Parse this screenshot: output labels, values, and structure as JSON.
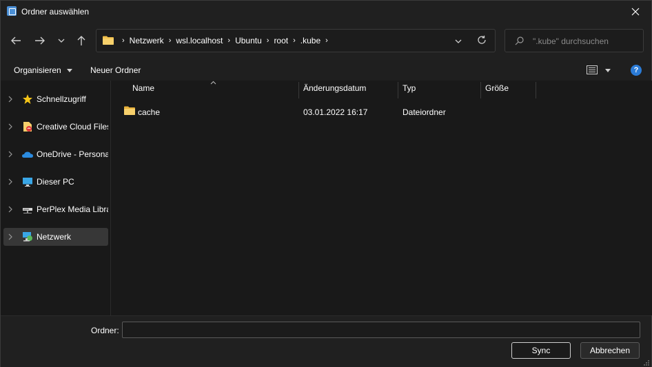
{
  "window": {
    "title": "Ordner auswählen"
  },
  "nav": {
    "breadcrumbs": [
      "Netzwerk",
      "wsl.localhost",
      "Ubuntu",
      "root",
      ".kube"
    ],
    "search_placeholder": "\".kube\" durchsuchen"
  },
  "commandbar": {
    "organize_label": "Organisieren",
    "new_folder_label": "Neuer Ordner",
    "help_label": "?"
  },
  "sidebar": {
    "items": [
      {
        "label": "Schnellzugriff",
        "icon": "star-icon"
      },
      {
        "label": "Creative Cloud Files",
        "icon": "creative-cloud-icon"
      },
      {
        "label": "OneDrive - Personal",
        "icon": "onedrive-cloud-icon"
      },
      {
        "label": "Dieser PC",
        "icon": "computer-icon"
      },
      {
        "label": "PerPlex Media Libra",
        "icon": "network-drive-icon"
      },
      {
        "label": "Netzwerk",
        "icon": "network-icon",
        "selected": true
      }
    ]
  },
  "columns": {
    "name": "Name",
    "date": "Änderungsdatum",
    "type": "Typ",
    "size": "Größe"
  },
  "files": [
    {
      "name": "cache",
      "date": "03.01.2022 16:17",
      "type": "Dateiordner",
      "size": ""
    }
  ],
  "bottom": {
    "folder_label": "Ordner:",
    "folder_value": "",
    "sync_label": "Sync",
    "cancel_label": "Abbrechen"
  },
  "colors": {
    "accent": "#2b7bd6",
    "folder": "#f2c14e",
    "background": "#191919"
  }
}
